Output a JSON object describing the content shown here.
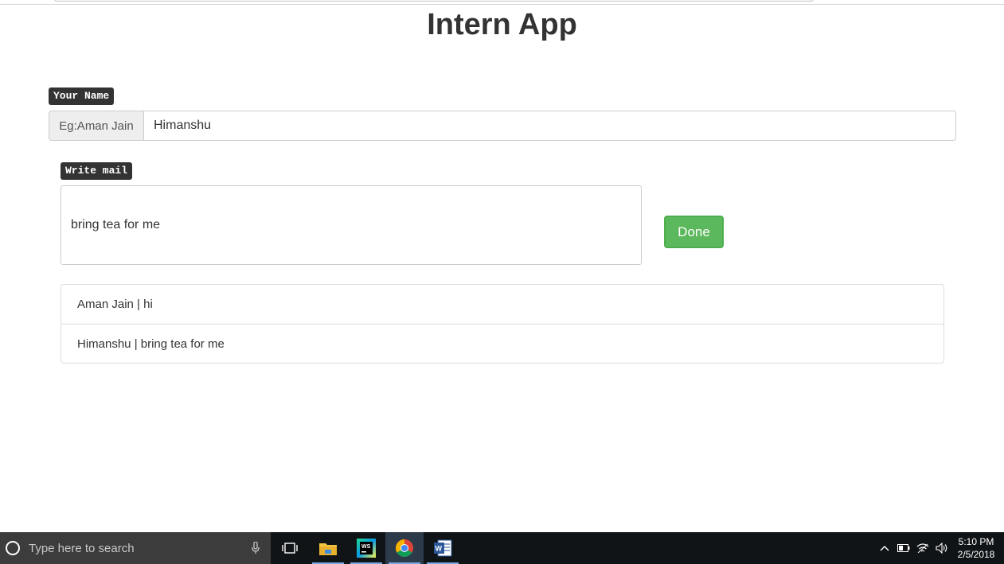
{
  "page": {
    "title": "Intern App"
  },
  "name_section": {
    "label": "Your Name",
    "addon_text": "Eg:Aman Jain",
    "input_value": "Himanshu"
  },
  "mail_section": {
    "label": "Write mail",
    "input_value": "bring tea for me",
    "done_label": "Done"
  },
  "messages": [
    "Aman Jain | hi",
    "Himanshu | bring tea for me"
  ],
  "taskbar": {
    "search_placeholder": "Type here to search",
    "apps": [
      "task-view-icon",
      "file-explorer-icon",
      "webstorm-icon",
      "chrome-icon",
      "word-icon"
    ],
    "tray_icons": [
      "chevron-up-icon",
      "battery-icon",
      "wifi-icon",
      "volume-icon"
    ],
    "time": "5:10 PM",
    "date": "2/5/2018"
  },
  "colors": {
    "done_button": "#5cb85c",
    "label_bg": "#333333",
    "taskbar_bg": "#101417"
  }
}
